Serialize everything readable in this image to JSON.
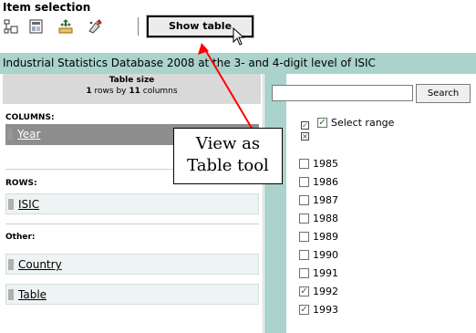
{
  "heading": "Item selection",
  "toolbar": {
    "show_table_label": "Show table",
    "icons": [
      "pivot-icon",
      "layout-icon",
      "move-icon",
      "clear-icon"
    ]
  },
  "title_bar": "Industrial Statistics Database 2008 at the 3- and 4-digit level of ISIC",
  "table_size": {
    "title": "Table size",
    "rows_count": "1",
    "rows_word": " rows by ",
    "columns_count": "11",
    "columns_word": " columns"
  },
  "sections": {
    "columns_label": "COLUMNS:",
    "columns_item": "Year",
    "rows_label": "ROWS:",
    "rows_item": "ISIC",
    "other_label": "Other:",
    "other_items": [
      "Country",
      "Table"
    ]
  },
  "search": {
    "value": "",
    "button_label": "Search",
    "select_range_label": "Select range",
    "select_range_checked": true
  },
  "years": [
    {
      "label": "1985",
      "checked": false
    },
    {
      "label": "1986",
      "checked": false
    },
    {
      "label": "1987",
      "checked": false
    },
    {
      "label": "1988",
      "checked": false
    },
    {
      "label": "1989",
      "checked": false
    },
    {
      "label": "1990",
      "checked": false
    },
    {
      "label": "1991",
      "checked": false
    },
    {
      "label": "1992",
      "checked": true
    },
    {
      "label": "1993",
      "checked": true
    }
  ],
  "callout": {
    "line1": "View as",
    "line2": "Table tool",
    "arrow_color": "#ff0000"
  },
  "colors": {
    "title_bar_bg": "#a9d3cb",
    "selected_row_bg": "#8d8d8d"
  }
}
